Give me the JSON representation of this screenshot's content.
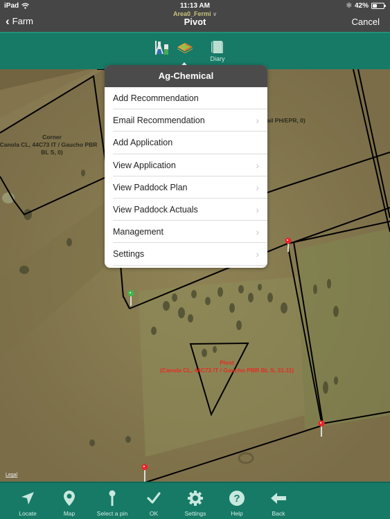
{
  "status_bar": {
    "device": "iPad",
    "time": "11:13 AM",
    "battery_percent_label": "42%",
    "battery_level": 0.42
  },
  "nav": {
    "back_label": "Farm",
    "area_selector": "Area0_Fermi",
    "title": "Pivot",
    "cancel_label": "Cancel"
  },
  "toolbar": {
    "tools": [
      {
        "icon": "chemical-flasks-icon",
        "label": ""
      },
      {
        "icon": "ag-layers-icon",
        "label": ""
      },
      {
        "icon": "diary-book-icon",
        "label": "Diary"
      }
    ]
  },
  "popover": {
    "title": "Ag-Chemical",
    "items": [
      {
        "label": "Add Recommendation",
        "has_chevron": false
      },
      {
        "label": "Email Recommendation",
        "has_chevron": true
      },
      {
        "label": "Add Application",
        "has_chevron": false
      },
      {
        "label": "View Application",
        "has_chevron": true
      },
      {
        "label": "View Paddock Plan",
        "has_chevron": true
      },
      {
        "label": "View Paddock Actuals",
        "has_chevron": true
      },
      {
        "label": "Management",
        "has_chevron": true
      },
      {
        "label": "Settings",
        "has_chevron": true
      }
    ]
  },
  "map": {
    "labels": {
      "corner_name": "Corner",
      "corner_line1": "Canola CL, 44C73 IT / Gaucho PBR",
      "corner_line2": "BL S, 0)",
      "partial_label": "ail  PH/EPR, 0)",
      "pivot_name": "Pivot",
      "pivot_detail": "(Canola CL, 44C73 IT / Gaucho PBR BL S, 31.11)"
    },
    "legal": "Legal",
    "colors": {
      "pivot_label": "#e52d23",
      "pin_red": "#e8262a",
      "pin_green": "#3cb84a"
    }
  },
  "bottom_bar": {
    "items": [
      {
        "icon": "locate-arrow-icon",
        "label": "Locate"
      },
      {
        "icon": "map-pin-icon",
        "label": "Map"
      },
      {
        "icon": "select-pin-icon",
        "label": "Select a pin"
      },
      {
        "icon": "checkmark-icon",
        "label": "OK"
      },
      {
        "icon": "gear-icon",
        "label": "Settings"
      },
      {
        "icon": "help-icon",
        "label": "Help"
      },
      {
        "icon": "back-arrow-icon",
        "label": "Back"
      }
    ]
  },
  "theme": {
    "header_bg": "#464646",
    "toolbar_bg": "#167a66",
    "popover_header_bg": "#4b4b4b"
  }
}
